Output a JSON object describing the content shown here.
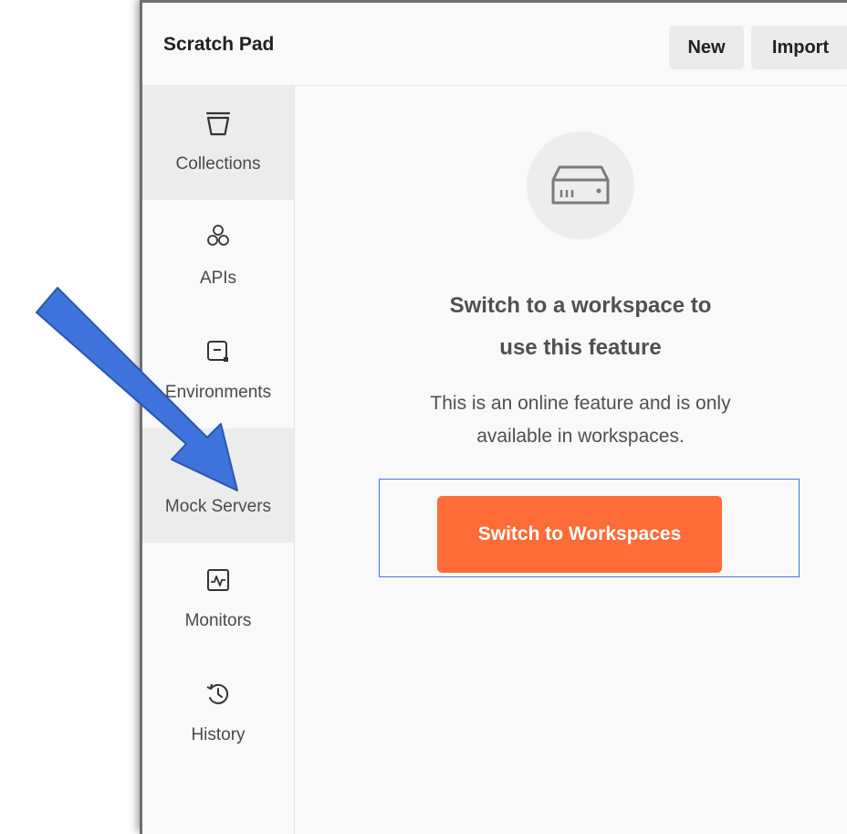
{
  "header": {
    "title": "Scratch Pad",
    "new_label": "New",
    "import_label": "Import"
  },
  "sidebar": {
    "items": [
      {
        "label": "Collections",
        "icon": "trash-bucket-icon",
        "active": true
      },
      {
        "label": "APIs",
        "icon": "hexagon-cluster-icon",
        "active": false
      },
      {
        "label": "Environments",
        "icon": "environment-icon",
        "active": false
      },
      {
        "label": "Mock Servers",
        "icon": "server-icon",
        "active": true
      },
      {
        "label": "Monitors",
        "icon": "pulse-icon",
        "active": false
      },
      {
        "label": "History",
        "icon": "history-clock-icon",
        "active": false
      }
    ]
  },
  "main": {
    "empty_icon": "server-icon",
    "title_line1": "Switch to a workspace to",
    "title_line2": "use this feature",
    "desc_line1": "This is an online feature and is only",
    "desc_line2": "available in workspaces.",
    "cta_label": "Switch to Workspaces"
  },
  "colors": {
    "cta": "#ff6c37",
    "annotation_arrow": "#3f74dd",
    "highlight_outline": "#3b78d8"
  }
}
